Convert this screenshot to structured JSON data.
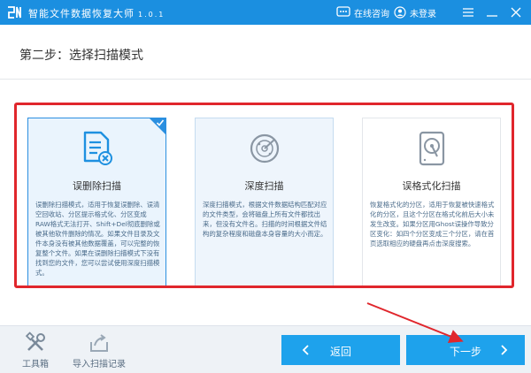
{
  "titlebar": {
    "app_name": "智能文件数据恢复大师",
    "version": "1.0.1",
    "online_help": "在线咨询",
    "login": "未登录",
    "icons": [
      "chat-icon",
      "user-icon",
      "menu-icon",
      "minimize-icon",
      "close-icon"
    ]
  },
  "step": {
    "title": "第二步：选择扫描模式"
  },
  "modes": [
    {
      "title": "误删除扫描",
      "description": "误删除扫描模式，适用于恢复误删除、误清空回收站、分区提示格式化、分区变成RAW格式无法打开、Shift+Del彻底删除或被其他软件删除的情况。如果文件目录及文件本身没有被其他数据覆盖，可以完整的恢复整个文件。如果在误删除扫描模式下没有找到您的文件，您可以尝试使用深度扫描模式。",
      "selected": true,
      "icon": "document-delete-icon"
    },
    {
      "title": "深度扫描",
      "description": "深度扫描模式，根据文件数据结构匹配对应的文件类型，会将磁盘上所有文件都找出来，但没有文件名。扫描的时间根据文件结构的复杂程度和磁盘本身容量的大小而定。",
      "selected": false,
      "icon": "radar-icon"
    },
    {
      "title": "误格式化扫描",
      "description": "恢复格式化的分区，适用于恢复被快速格式化的分区，且这个分区在格式化前后大小未发生改变。如果分区用Ghost误操作导致分区变化：如四个分区变成三个分区，请在首页选取相应的硬盘再点击深度搜索。",
      "selected": false,
      "icon": "hard-disk-icon"
    }
  ],
  "bottombar": {
    "toolbox": "工具箱",
    "import_record": "导入扫描记录",
    "back": "返回",
    "next": "下一步"
  },
  "colors": {
    "titlebar": "#1b8fe0",
    "button": "#1ea2ec",
    "annotation": "#e0262c"
  }
}
